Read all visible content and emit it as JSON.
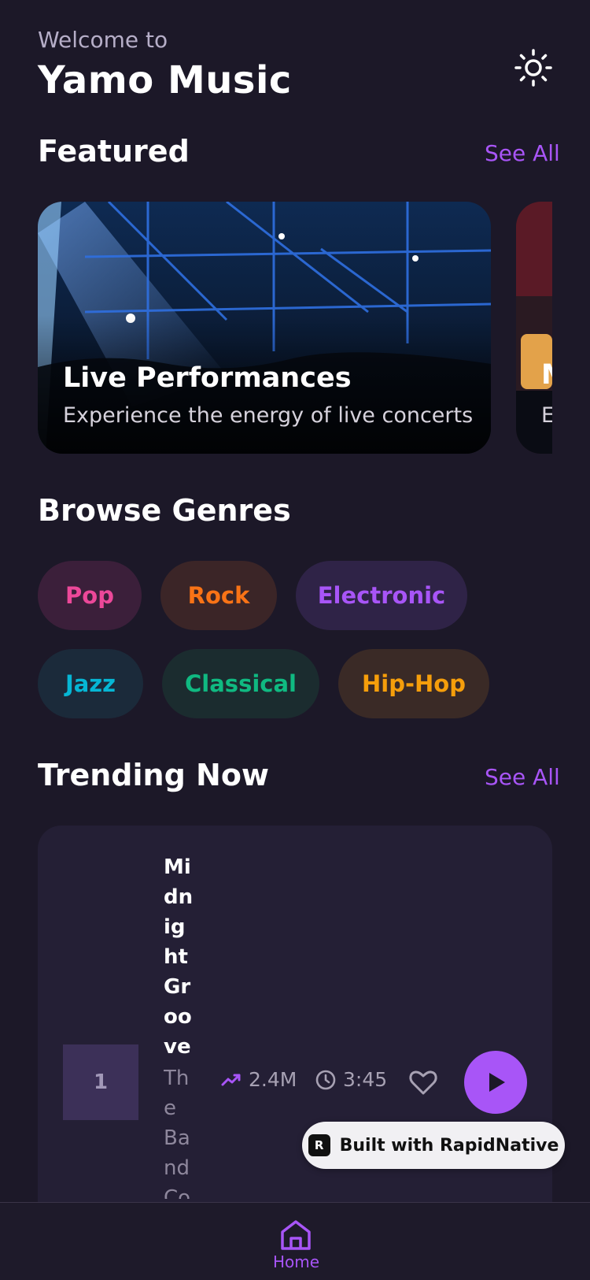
{
  "header": {
    "welcome": "Welcome to",
    "title": "Yamo Music",
    "theme_icon": "sun-icon"
  },
  "featured": {
    "heading": "Featured",
    "see_all": "See All",
    "cards": [
      {
        "title": "Live Performances",
        "subtitle": "Experience the energy of live concerts"
      },
      {
        "title": "M",
        "subtitle": "E"
      }
    ]
  },
  "genres": {
    "heading": "Browse Genres",
    "items": [
      {
        "label": "Pop",
        "color": "#ec4899",
        "bg": "#3b1f3a"
      },
      {
        "label": "Rock",
        "color": "#f97316",
        "bg": "#3b2527"
      },
      {
        "label": "Electronic",
        "color": "#a855f7",
        "bg": "#2f2347"
      },
      {
        "label": "Jazz",
        "color": "#06b6d4",
        "bg": "#1b2a3a"
      },
      {
        "label": "Classical",
        "color": "#10b981",
        "bg": "#1b2c2f"
      },
      {
        "label": "Hip-Hop",
        "color": "#f59e0b",
        "bg": "#3a2a26"
      }
    ]
  },
  "trending": {
    "heading": "Trending Now",
    "see_all": "See All",
    "items": [
      {
        "rank": "1",
        "title": "Midnight Groove",
        "artist": "The Band Co",
        "plays": "2.4M",
        "duration": "3:45"
      }
    ]
  },
  "badge": {
    "logo": "R",
    "label": "Built with RapidNative"
  },
  "nav": {
    "home_label": "Home"
  },
  "colors": {
    "accent": "#a855f7",
    "background": "#1c1828"
  }
}
